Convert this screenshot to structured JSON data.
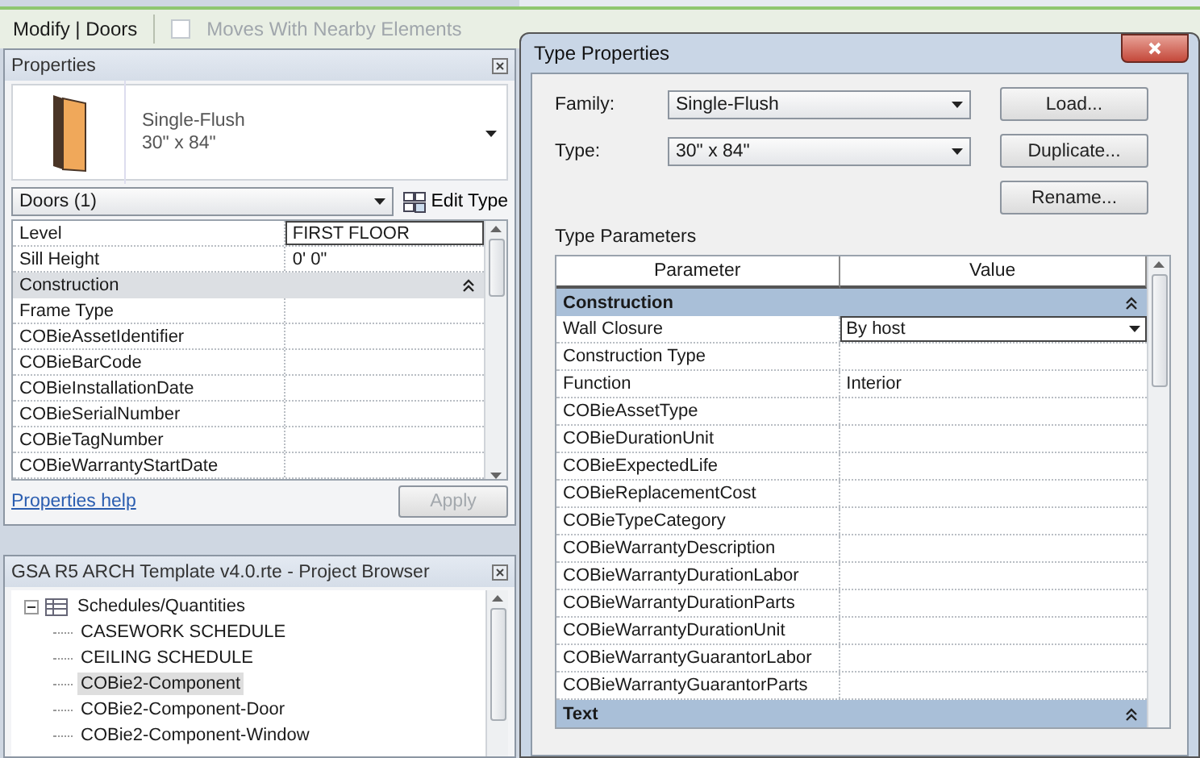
{
  "ribbon": {
    "context": "Modify | Doors",
    "option": {
      "label": "Moves With Nearby Elements",
      "checked": false,
      "disabled": true
    }
  },
  "properties": {
    "title": "Properties",
    "family": "Single-Flush",
    "type": "30\" x 84\"",
    "selector": "Doors (1)",
    "edit_type": "Edit Type",
    "rows": [
      {
        "kind": "param",
        "name": "Level",
        "value": "FIRST FLOOR",
        "editing": true
      },
      {
        "kind": "param",
        "name": "Sill Height",
        "value": "0'  0\"",
        "editing": false
      },
      {
        "kind": "group",
        "name": "Construction"
      },
      {
        "kind": "param",
        "name": "Frame Type",
        "value": "",
        "editing": false
      },
      {
        "kind": "param",
        "name": "COBieAssetIdentifier",
        "value": "",
        "editing": false
      },
      {
        "kind": "param",
        "name": "COBieBarCode",
        "value": "",
        "editing": false
      },
      {
        "kind": "param",
        "name": "COBieInstallationDate",
        "value": "",
        "editing": false
      },
      {
        "kind": "param",
        "name": "COBieSerialNumber",
        "value": "",
        "editing": false
      },
      {
        "kind": "param",
        "name": "COBieTagNumber",
        "value": "",
        "editing": false
      },
      {
        "kind": "param",
        "name": "COBieWarrantyStartDate",
        "value": "",
        "editing": false
      }
    ],
    "help": "Properties help",
    "apply": {
      "label": "Apply",
      "disabled": true
    }
  },
  "project_browser": {
    "title": "GSA R5 ARCH Template v4.0.rte - Project Browser",
    "items": [
      {
        "label": "Schedules/Quantities",
        "expanded": true,
        "selected": false,
        "children": [
          {
            "label": "CASEWORK SCHEDULE",
            "selected": false
          },
          {
            "label": "CEILING SCHEDULE",
            "selected": false
          },
          {
            "label": "COBie2-Component",
            "selected": true
          },
          {
            "label": "COBie2-Component-Door",
            "selected": false
          },
          {
            "label": "COBie2-Component-Window",
            "selected": false
          }
        ]
      }
    ]
  },
  "dialog": {
    "title": "Type Properties",
    "family": {
      "label": "Family:",
      "value": "Single-Flush"
    },
    "type": {
      "label": "Type:",
      "value": "30\" x 84\""
    },
    "buttons": [
      {
        "label": "Load..."
      },
      {
        "label": "Duplicate..."
      },
      {
        "label": "Rename..."
      }
    ],
    "section": "Type Parameters",
    "columns": [
      "Parameter",
      "Value"
    ],
    "rows": [
      {
        "kind": "group",
        "name": "Construction"
      },
      {
        "kind": "dropdown",
        "name": "Wall Closure",
        "value": "By host"
      },
      {
        "kind": "param",
        "name": "Construction Type",
        "value": ""
      },
      {
        "kind": "param",
        "name": "Function",
        "value": "Interior"
      },
      {
        "kind": "param",
        "name": "COBieAssetType",
        "value": ""
      },
      {
        "kind": "param",
        "name": "COBieDurationUnit",
        "value": ""
      },
      {
        "kind": "param",
        "name": "COBieExpectedLife",
        "value": ""
      },
      {
        "kind": "param",
        "name": "COBieReplacementCost",
        "value": ""
      },
      {
        "kind": "param",
        "name": "COBieTypeCategory",
        "value": ""
      },
      {
        "kind": "param",
        "name": "COBieWarrantyDescription",
        "value": ""
      },
      {
        "kind": "param",
        "name": "COBieWarrantyDurationLabor",
        "value": ""
      },
      {
        "kind": "param",
        "name": "COBieWarrantyDurationParts",
        "value": ""
      },
      {
        "kind": "param",
        "name": "COBieWarrantyDurationUnit",
        "value": ""
      },
      {
        "kind": "param",
        "name": "COBieWarrantyGuarantorLabor",
        "value": ""
      },
      {
        "kind": "param",
        "name": "COBieWarrantyGuarantorParts",
        "value": ""
      },
      {
        "kind": "group",
        "name": "Text"
      }
    ]
  }
}
